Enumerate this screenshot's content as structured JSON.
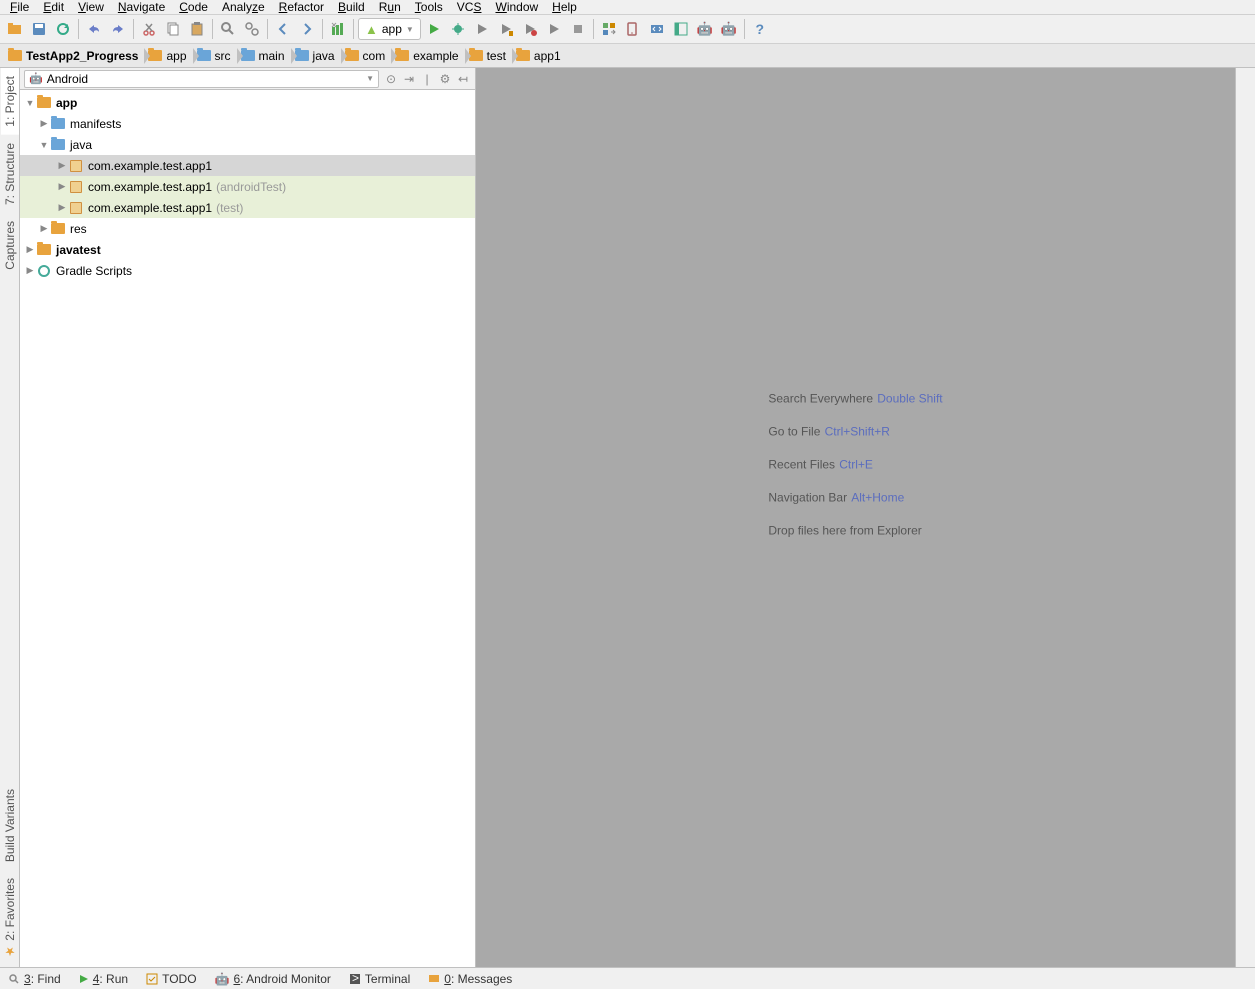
{
  "menu": [
    "File",
    "Edit",
    "View",
    "Navigate",
    "Code",
    "Analyze",
    "Refactor",
    "Build",
    "Run",
    "Tools",
    "VCS",
    "Window",
    "Help"
  ],
  "menu_underline": [
    0,
    0,
    0,
    0,
    0,
    4,
    0,
    0,
    1,
    0,
    2,
    0,
    0
  ],
  "run_config": "app",
  "breadcrumb": [
    "TestApp2_Progress",
    "app",
    "src",
    "main",
    "java",
    "com",
    "example",
    "test",
    "app1"
  ],
  "project_view": {
    "dropdown": "Android",
    "tree": {
      "app": "app",
      "manifests": "manifests",
      "java": "java",
      "pkg1": "com.example.test.app1",
      "pkg2": "com.example.test.app1",
      "pkg2_suffix": "(androidTest)",
      "pkg3": "com.example.test.app1",
      "pkg3_suffix": "(test)",
      "res": "res",
      "javatest": "javatest",
      "gradle": "Gradle Scripts"
    }
  },
  "left_tabs": {
    "project": "1: Project",
    "structure": "7: Structure",
    "captures": "Captures",
    "build_variants": "Build Variants",
    "favorites": "2: Favorites"
  },
  "hints": [
    {
      "label": "Search Everywhere",
      "shortcut": "Double Shift"
    },
    {
      "label": "Go to File",
      "shortcut": "Ctrl+Shift+R"
    },
    {
      "label": "Recent Files",
      "shortcut": "Ctrl+E"
    },
    {
      "label": "Navigation Bar",
      "shortcut": "Alt+Home"
    },
    {
      "label": "Drop files here from Explorer",
      "shortcut": ""
    }
  ],
  "bottom": {
    "find": "3: Find",
    "run": "4: Run",
    "todo": "TODO",
    "monitor": "6: Android Monitor",
    "terminal": "Terminal",
    "messages": "0: Messages"
  }
}
